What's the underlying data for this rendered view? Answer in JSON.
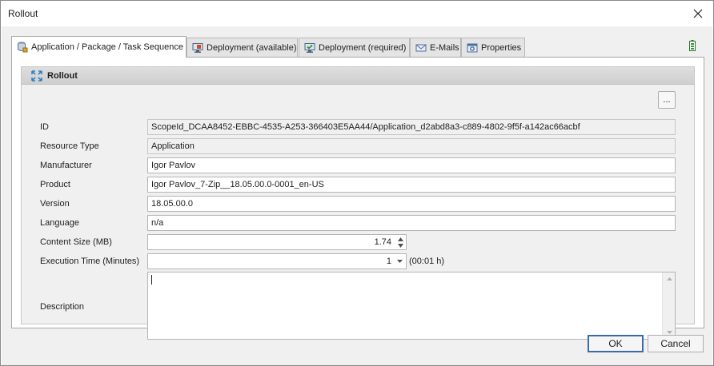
{
  "window": {
    "title": "Rollout"
  },
  "tabs": [
    {
      "label": "Application / Package / Task Sequence",
      "icon": "database-icon",
      "active": true
    },
    {
      "label": "Deployment (available)",
      "icon": "monitor-icon",
      "active": false
    },
    {
      "label": "Deployment (required)",
      "icon": "monitor-check-icon",
      "active": false
    },
    {
      "label": "E-Mails",
      "icon": "envelope-icon",
      "active": false
    },
    {
      "label": "Properties",
      "icon": "properties-icon",
      "active": false
    }
  ],
  "group": {
    "title": "Rollout",
    "icon": "rollout-icon"
  },
  "form": {
    "id": {
      "label": "ID",
      "value": "ScopeId_DCAA8452-EBBC-4535-A253-366403E5AA44/Application_d2abd8a3-c889-4802-9f5f-a142ac66acbf",
      "button": "..."
    },
    "resource_type": {
      "label": "Resource Type",
      "value": "Application"
    },
    "manufacturer": {
      "label": "Manufacturer",
      "value": "Igor Pavlov"
    },
    "product": {
      "label": "Product",
      "value": "Igor Pavlov_7-Zip__18.05.00.0-0001_en-US"
    },
    "version": {
      "label": "Version",
      "value": "18.05.00.0"
    },
    "language": {
      "label": "Language",
      "value": "n/a"
    },
    "content_size": {
      "label": "Content Size (MB)",
      "value": "1.74"
    },
    "execution_time": {
      "label": "Execution Time (Minutes)",
      "value": "1",
      "hint": "(00:01 h)"
    },
    "description": {
      "label": "Description",
      "value": ""
    }
  },
  "buttons": {
    "ok": "OK",
    "cancel": "Cancel"
  },
  "colors": {
    "accent": "#3c6aa8",
    "panel_bg": "#f0f0f0",
    "header_bg": "#d6d6d6"
  }
}
